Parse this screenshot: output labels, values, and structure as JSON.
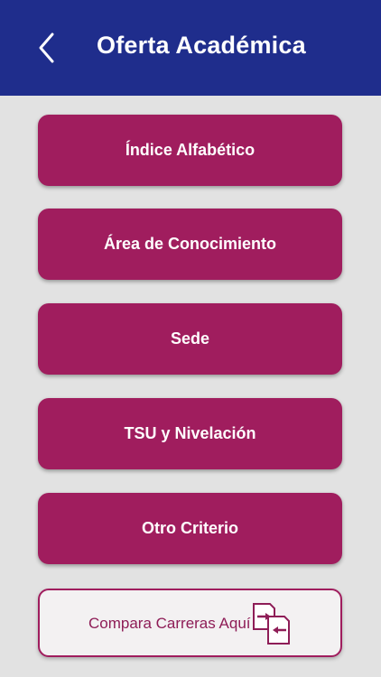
{
  "header": {
    "title": "Oferta Académica",
    "back_icon": "chevron-left-icon"
  },
  "menu": {
    "items": [
      {
        "label": "Índice Alfabético"
      },
      {
        "label": "Área de Conocimiento"
      },
      {
        "label": "Sede"
      },
      {
        "label": "TSU y Nivelación"
      },
      {
        "label": "Otro Criterio"
      }
    ]
  },
  "compare": {
    "label": "Compara Carreras Aquí",
    "icon": "compare-documents-icon"
  },
  "colors": {
    "header_bg": "#1f2d8c",
    "button_bg": "#a01d5e",
    "page_bg": "#e2e2e2",
    "compare_bg": "#f3f1f2"
  }
}
